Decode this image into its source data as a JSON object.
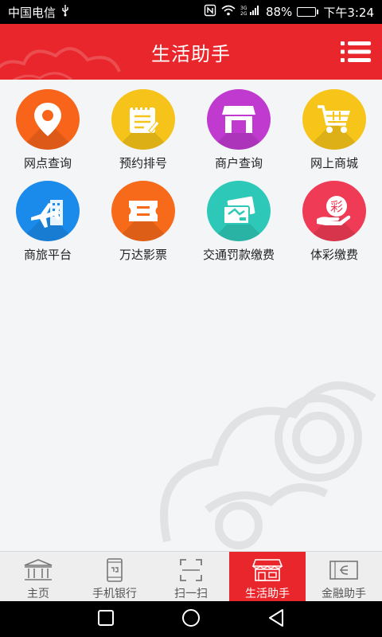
{
  "status_bar": {
    "carrier": "中国电信",
    "battery_percent": "88%",
    "battery_level": 0.88,
    "time": "下午3:24"
  },
  "header": {
    "title": "生活助手"
  },
  "grid": [
    {
      "label": "网点查询",
      "icon": "location-pin-icon",
      "color": "#f7641a"
    },
    {
      "label": "预约排号",
      "icon": "notepad-icon",
      "color": "#f6c31a"
    },
    {
      "label": "商户查询",
      "icon": "storefront-icon",
      "color": "#c03ad0"
    },
    {
      "label": "网上商城",
      "icon": "shopping-cart-icon",
      "color": "#f7c51a"
    },
    {
      "label": "商旅平台",
      "icon": "airplane-icon",
      "color": "#1a8bea"
    },
    {
      "label": "万达影票",
      "icon": "ticket-icon",
      "color": "#f76a1a"
    },
    {
      "label": "交通罚款缴费",
      "icon": "card-payment-icon",
      "color": "#2ec8b8"
    },
    {
      "label": "体彩缴费",
      "icon": "lottery-hand-icon",
      "color": "#ef3b55"
    }
  ],
  "lottery_char": "彩",
  "tabs": [
    {
      "label": "主页",
      "icon": "bank-building-icon",
      "active": false
    },
    {
      "label": "手机银行",
      "icon": "mobile-phone-icon",
      "active": false
    },
    {
      "label": "扫一扫",
      "icon": "scan-icon",
      "active": false
    },
    {
      "label": "生活助手",
      "icon": "shop-icon",
      "active": true
    },
    {
      "label": "金融助手",
      "icon": "finance-icon",
      "active": false
    }
  ],
  "colors": {
    "brand_red": "#e8262b",
    "background": "#f4f5f7"
  }
}
